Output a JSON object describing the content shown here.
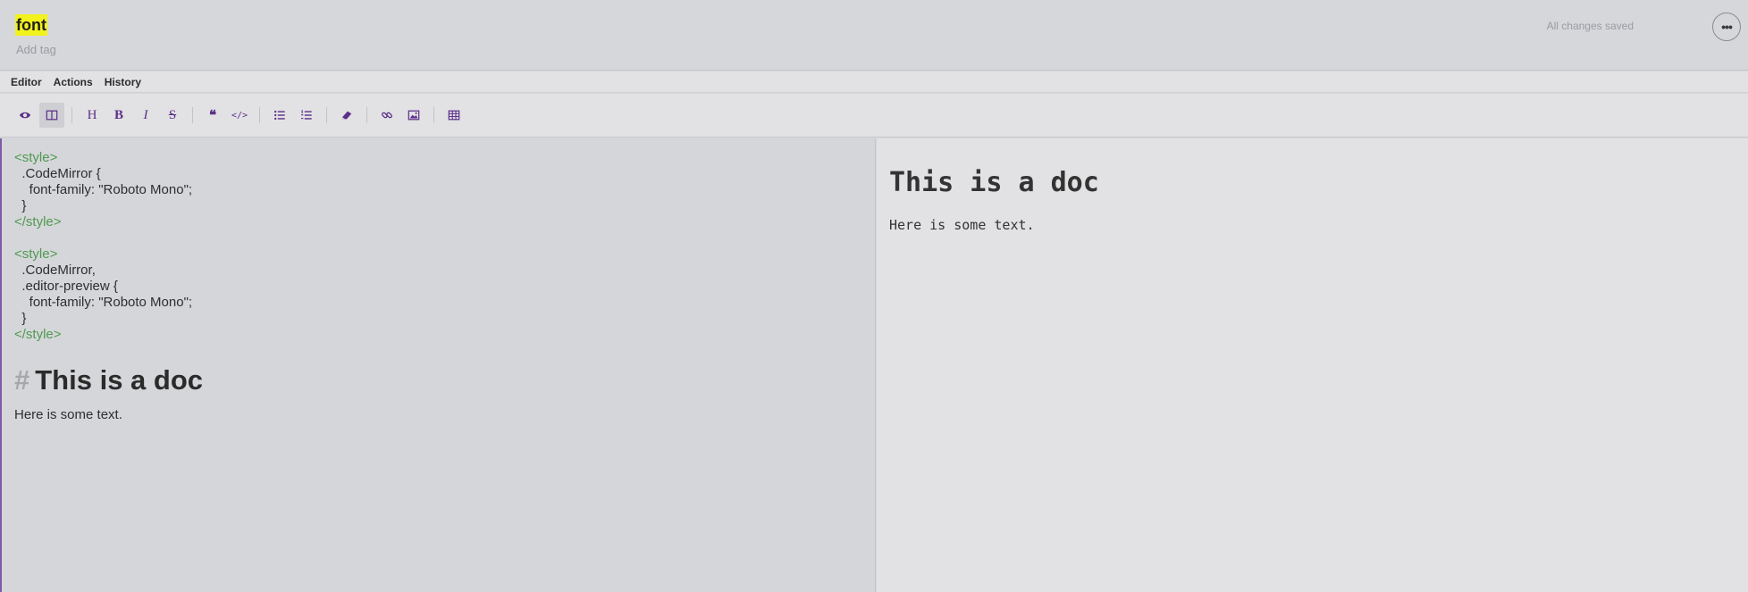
{
  "note": {
    "title": "font",
    "tag_placeholder": "Add tag",
    "save_status": "All changes saved",
    "more_label": "•••"
  },
  "menu": {
    "items": [
      "Editor",
      "Actions",
      "History"
    ]
  },
  "toolbar": {
    "buttons": [
      {
        "name": "preview-toggle",
        "icon": "eye-icon"
      },
      {
        "name": "side-by-side-toggle",
        "icon": "columns-icon"
      },
      {
        "name": "heading",
        "icon": "heading-icon",
        "glyph": "H"
      },
      {
        "name": "bold",
        "icon": "bold-icon",
        "glyph": "B"
      },
      {
        "name": "italic",
        "icon": "italic-icon",
        "glyph": "I"
      },
      {
        "name": "strikethrough",
        "icon": "strikethrough-icon",
        "glyph": "S"
      },
      {
        "name": "quote",
        "icon": "quote-icon",
        "glyph": "❝"
      },
      {
        "name": "code",
        "icon": "code-icon",
        "glyph": "</>"
      },
      {
        "name": "unordered-list",
        "icon": "bullet-list-icon"
      },
      {
        "name": "ordered-list",
        "icon": "numbered-list-icon"
      },
      {
        "name": "clear-formatting",
        "icon": "eraser-icon"
      },
      {
        "name": "link",
        "icon": "link-icon"
      },
      {
        "name": "image",
        "icon": "image-icon"
      },
      {
        "name": "table",
        "icon": "table-icon"
      }
    ]
  },
  "editor": {
    "block1": [
      "<style>",
      "  .CodeMirror {",
      "    font-family: \"Roboto Mono\";",
      "  }",
      "</style>"
    ],
    "block2": [
      "<style>",
      "  .CodeMirror,",
      "  .editor-preview {",
      "    font-family: \"Roboto Mono\";",
      "  }",
      "</style>"
    ],
    "heading_hash": "#",
    "heading": "This is a doc",
    "text": "Here is some text."
  },
  "preview": {
    "heading": "This is a doc",
    "text": "Here is some text."
  },
  "colors": {
    "accent": "#5b2f8a",
    "highlight": "#f2f21c",
    "code_tag": "#4f9a4f"
  }
}
